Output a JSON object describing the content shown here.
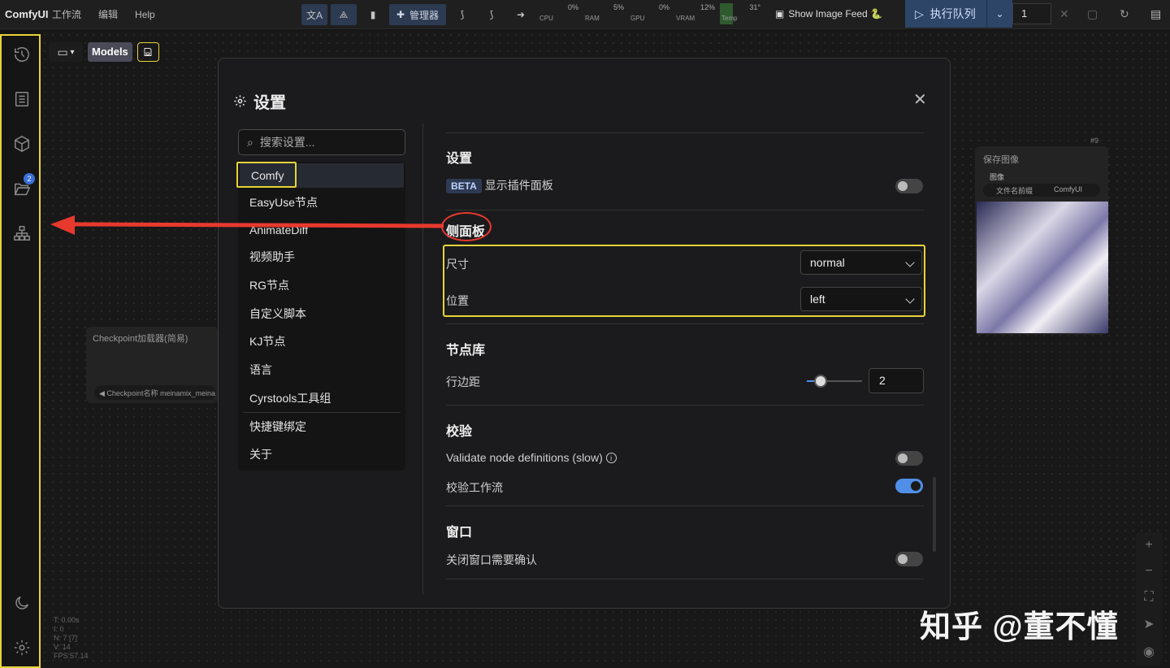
{
  "app": {
    "brand": "ComfyUI"
  },
  "topbar": {
    "menu": [
      "工作流",
      "编辑",
      "Help"
    ],
    "manager_label": "管理器",
    "meters": [
      {
        "label": "CPU",
        "value": "0%"
      },
      {
        "label": "RAM",
        "value": "5%"
      },
      {
        "label": "GPU",
        "value": "0%"
      },
      {
        "label": "VRAM",
        "value": "12%"
      },
      {
        "label": "Temp",
        "value": "31°"
      }
    ],
    "show_image_feed": "Show Image Feed 🐍",
    "run_label": "执行队列",
    "queue_count": "1"
  },
  "workspace": {
    "models_label": "Models",
    "sidebar_badge": "2"
  },
  "nodes": {
    "checkpoint_title": "Checkpoint加载器(简易)",
    "checkpoint_field": "◀ Checkpoint名称  meinamix_meina",
    "save_title": "保存图像",
    "save_id": "#9",
    "save_input": "图像",
    "save_prefix_label": "文件名前缀",
    "save_prefix_value": "ComfyUI"
  },
  "stats": [
    "T: 0.00s",
    "I: 0",
    "N: 7 [7]",
    "V: 14",
    "FPS:57.14"
  ],
  "watermark": "知乎 @董不懂",
  "dialog": {
    "title": "设置",
    "search_placeholder": "搜索设置...",
    "categories": [
      "Comfy",
      "EasyUse节点",
      "AnimateDiff",
      "视频助手",
      "RG节点",
      "自定义脚本",
      "KJ节点",
      "语言",
      "Cyrstools工具组",
      "快捷键绑定",
      "关于"
    ],
    "sections": {
      "settings": {
        "title": "设置",
        "beta": "BETA",
        "plugin_panel_label": "显示插件面板",
        "plugin_panel_on": false
      },
      "sidebar": {
        "title": "侧面板",
        "size_label": "尺寸",
        "size_value": "normal",
        "position_label": "位置",
        "position_value": "left"
      },
      "node_library": {
        "title": "节点库",
        "row_spacing_label": "行边距",
        "row_spacing_value": "2"
      },
      "validation": {
        "title": "校验",
        "validate_defs_label": "Validate node definitions (slow)",
        "validate_defs_on": false,
        "validate_workflow_label": "校验工作流",
        "validate_workflow_on": true
      },
      "window": {
        "title": "窗口",
        "confirm_close_label": "关闭窗口需要确认",
        "confirm_close_on": false
      }
    }
  },
  "colors": {
    "highlight": "#e8d33a",
    "annotation_red": "#e8392e",
    "accent": "#4f8fe8"
  }
}
